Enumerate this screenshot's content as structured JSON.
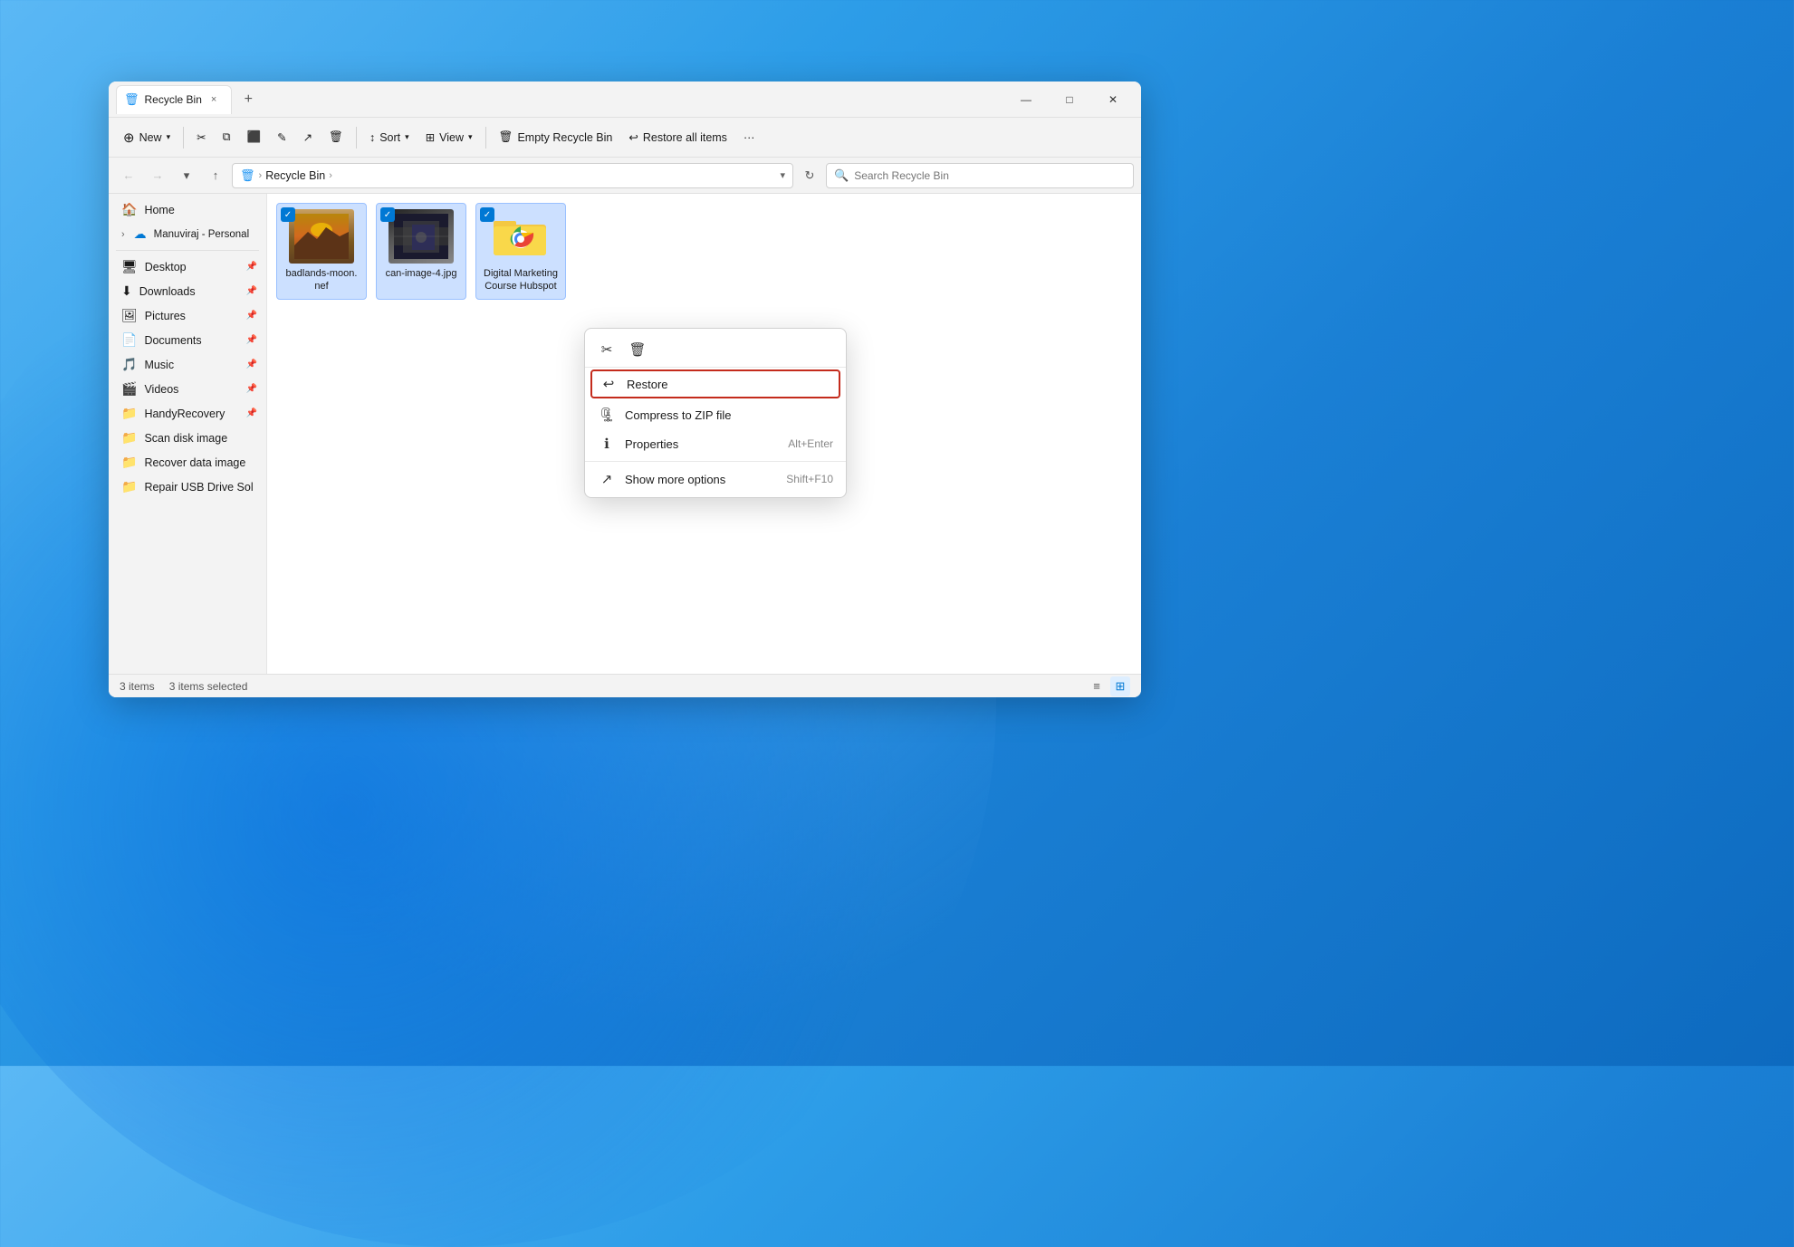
{
  "window": {
    "title": "Recycle Bin",
    "tab_label": "Recycle Bin",
    "tab_close_label": "×",
    "new_tab_label": "+",
    "minimize_label": "—",
    "maximize_label": "□",
    "close_label": "✕"
  },
  "toolbar": {
    "new_label": "New",
    "new_dropdown": "▾",
    "cut_icon": "✂",
    "copy_icon": "⧉",
    "paste_icon": "📋",
    "rename_icon": "✎",
    "share_icon": "↗",
    "delete_icon": "🗑",
    "sort_label": "Sort",
    "sort_dropdown": "▾",
    "view_label": "View",
    "view_dropdown": "▾",
    "empty_recycle_label": "Empty Recycle Bin",
    "restore_all_label": "Restore all items",
    "more_label": "···"
  },
  "addressbar": {
    "back_icon": "←",
    "forward_icon": "→",
    "recent_icon": "▾",
    "up_icon": "↑",
    "breadcrumb_icon": "🗑",
    "breadcrumb_items": [
      "Recycle Bin"
    ],
    "dropdown_icon": "▾",
    "refresh_icon": "↻",
    "search_placeholder": "Search Recycle Bin"
  },
  "sidebar": {
    "items": [
      {
        "icon": "🏠",
        "label": "Home",
        "pin": false,
        "active": false
      },
      {
        "icon": "☁",
        "label": "Manuviraj - Personal",
        "pin": false,
        "active": false,
        "expandable": true
      }
    ],
    "quick_access": [
      {
        "icon": "🖥",
        "label": "Desktop",
        "pin": true
      },
      {
        "icon": "⬇",
        "label": "Downloads",
        "pin": true
      },
      {
        "icon": "🖼",
        "label": "Pictures",
        "pin": true
      },
      {
        "icon": "📄",
        "label": "Documents",
        "pin": true
      },
      {
        "icon": "🎵",
        "label": "Music",
        "pin": true
      },
      {
        "icon": "🎬",
        "label": "Videos",
        "pin": true
      }
    ],
    "folders": [
      {
        "icon": "📁",
        "label": "HandyRecovery",
        "pin": true
      },
      {
        "icon": "📁",
        "label": "Scan disk image"
      },
      {
        "icon": "📁",
        "label": "Recover data image"
      },
      {
        "icon": "📁",
        "label": "Repair USB Drive Sol"
      }
    ]
  },
  "files": [
    {
      "name": "badlands-moon.nef",
      "type": "nef",
      "selected": true,
      "checkbox": true
    },
    {
      "name": "can-image-4.jpg",
      "type": "jpg",
      "selected": true,
      "checkbox": true
    },
    {
      "name": "Digital Marketing Course Hubspot",
      "type": "folder",
      "selected": true,
      "checkbox": true
    }
  ],
  "context_menu": {
    "cut_icon": "✂",
    "delete_icon": "🗑",
    "restore_icon": "↩",
    "restore_label": "Restore",
    "zip_icon": "🗜",
    "zip_label": "Compress to ZIP file",
    "properties_icon": "ℹ",
    "properties_label": "Properties",
    "properties_shortcut": "Alt+Enter",
    "more_icon": "↗",
    "more_label": "Show more options",
    "more_shortcut": "Shift+F10"
  },
  "statusbar": {
    "item_count": "3 items",
    "selected_count": "3 items selected"
  },
  "colors": {
    "accent": "#0078d4",
    "selected_bg": "#cce0ff",
    "selected_border": "#99c0ff",
    "restore_highlight": "#c42b1c",
    "folder_yellow": "#F4C842"
  }
}
